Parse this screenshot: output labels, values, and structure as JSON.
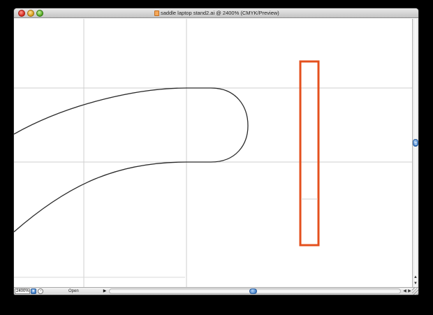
{
  "window": {
    "title": "saddle laptop stand2.ai @ 2400% (CMYK/Preview)",
    "traffic_lights": [
      "close",
      "minimize",
      "zoom"
    ]
  },
  "canvas": {
    "guide_color": "#cfcfcf",
    "path_color": "#2a2a2a",
    "selection_color": "#e4501e"
  },
  "statusbar": {
    "zoom_value": "2400%",
    "zoom_dropdown_icon": "chevron-down-icon",
    "navigator_icon": "navigator-icon",
    "status_text": "Open",
    "status_menu_icon": "triangle-right-icon"
  },
  "scrollbars": {
    "vertical_up_icon": "arrow-up-icon",
    "vertical_down_icon": "arrow-down-icon",
    "horizontal_left_icon": "arrow-left-icon",
    "horizontal_right_icon": "arrow-right-icon"
  },
  "glyphs": {
    "chevron_down": "▾",
    "navigator": "◔",
    "triangle_right": "▶",
    "arrow_up": "▲",
    "arrow_down": "▼",
    "arrow_left": "◀",
    "arrow_right": "▶"
  }
}
